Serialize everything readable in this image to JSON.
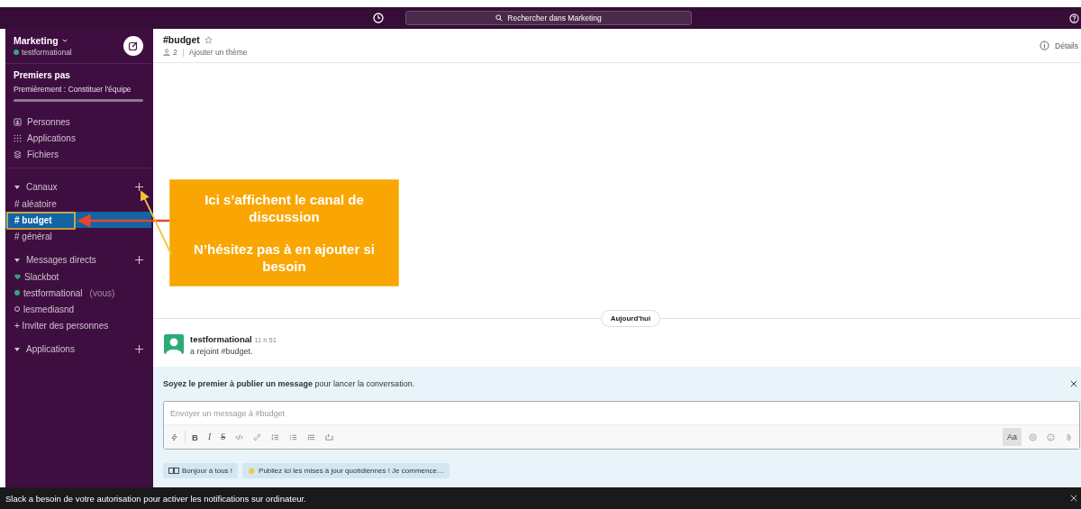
{
  "topbar": {
    "search_placeholder": "Rechercher dans Marketing"
  },
  "workspace": {
    "name": "Marketing",
    "user": "testformational"
  },
  "onboarding": {
    "title": "Premiers pas",
    "step": "Premièrement : Constituer l'équipe"
  },
  "nav": [
    {
      "label": "Personnes",
      "kind": "people"
    },
    {
      "label": "Applications",
      "kind": "apps"
    },
    {
      "label": "Fichiers",
      "kind": "files"
    }
  ],
  "sections": [
    {
      "title": "Canaux",
      "expanded": true,
      "items": [
        {
          "label": "# aléatoire",
          "kind": "channel",
          "selected": false
        },
        {
          "label": "# budget",
          "kind": "channel",
          "selected": true
        },
        {
          "label": "# général",
          "kind": "channel",
          "selected": false
        }
      ]
    },
    {
      "title": "Messages directs",
      "expanded": true,
      "items": [
        {
          "label": "Slackbot",
          "kind": "bot",
          "selected": false
        },
        {
          "label": "testformational",
          "note": "(vous)",
          "kind": "online",
          "selected": false
        },
        {
          "label": "lesmediasnd",
          "kind": "away",
          "selected": false
        },
        {
          "label": "+ Inviter des personnes",
          "kind": "invite",
          "selected": false
        }
      ]
    },
    {
      "title": "Applications",
      "expanded": true
    }
  ],
  "channel": {
    "name": "#budget",
    "starred": false,
    "members": "2",
    "topic": "Ajouter un thème",
    "details": "Détails"
  },
  "annotation": {
    "lines": [
      "Ici s’affichent le canal de discussion",
      "N’hésitez pas à en ajouter si besoin"
    ]
  },
  "date_divider": "Aujourd'hui",
  "message": {
    "author": "testformational",
    "time": "11 h 51",
    "text": "a rejoint #budget."
  },
  "composer": {
    "prompt": "**Soyez le premier à publier un message** pour lancer la conversation.",
    "placeholder": "Envoyer un message à #budget",
    "format_button": "Aa",
    "text_styles": [
      {
        "label": "B",
        "kind": "bold"
      },
      {
        "label": "I",
        "kind": "italic"
      },
      {
        "label": "S",
        "kind": "strike"
      }
    ],
    "suggestions": [
      {
        "label": "Bonjour à tous !",
        "kind": "book"
      },
      {
        "label": "Publiez ici les mises à jour quotidiennes ! Je commence…",
        "kind": "wave"
      }
    ]
  },
  "notification": "Slack a besoin de votre autorisation pour activer les notifications sur ordinateur."
}
